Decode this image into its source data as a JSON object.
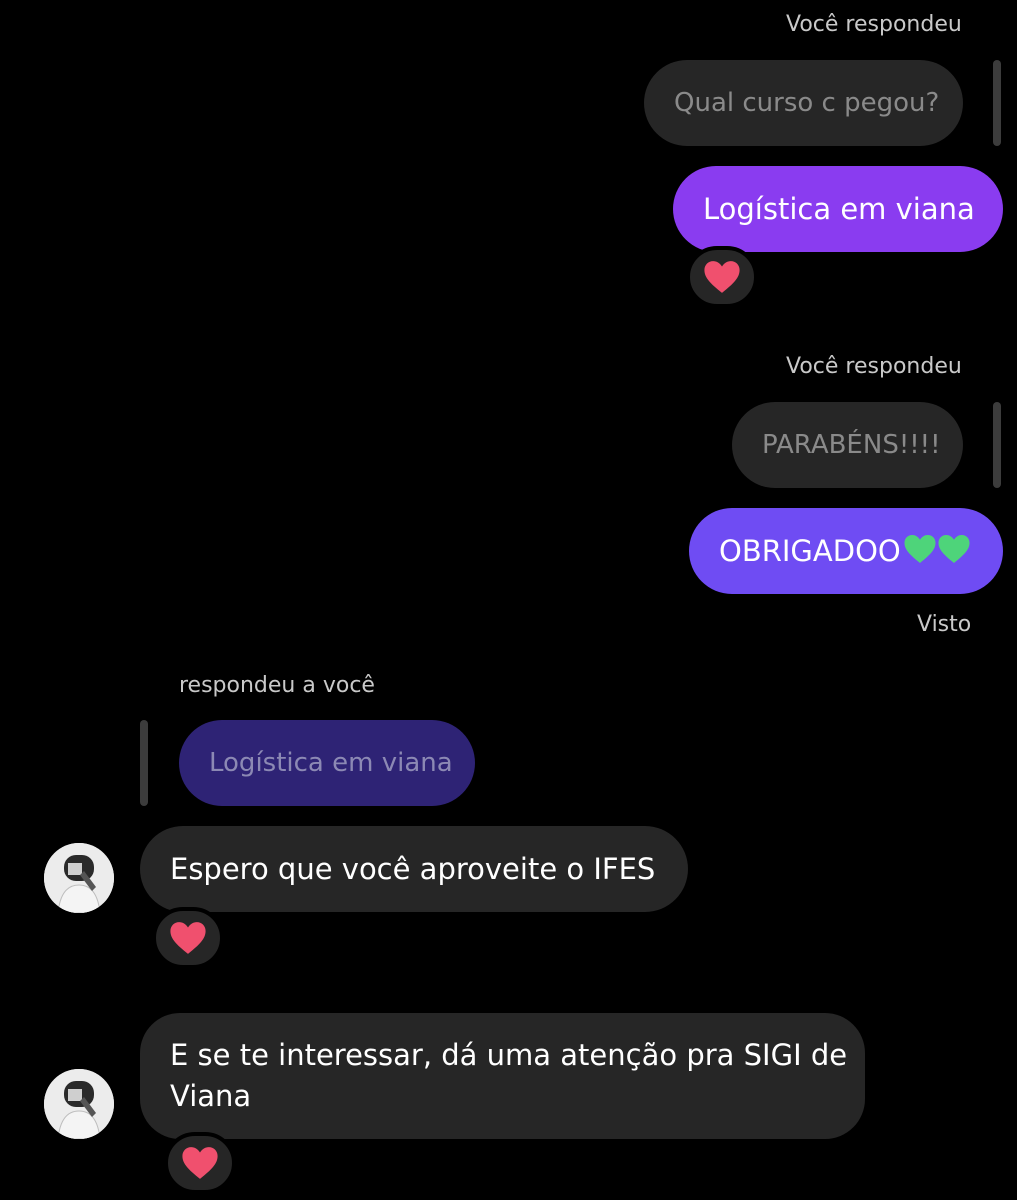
{
  "thread": {
    "reply_label_1": "Você respondeu",
    "quoted_1": "Qual curso c pegou?",
    "sent_1": "Logística em viana",
    "reply_label_2": "Você respondeu",
    "quoted_2": "PARABÉNS!!!!",
    "sent_2": "OBRIGADOO",
    "seen_label": "Visto",
    "reply_label_3": "respondeu a você",
    "quoted_3": "Logística em viana",
    "received_1": "Espero que você aproveite o IFES",
    "received_2_line1": "E se te interessar, dá uma atenção pra SIGI de",
    "received_2_line2": "Viana"
  },
  "colors": {
    "background": "#000000",
    "sent_bubble_1": "#8a3cf0",
    "sent_bubble_2": "#6f4cf3",
    "received_bubble": "#262626",
    "quoted_purple": "#2e2375",
    "heart_red": "#f0506e",
    "heart_green": "#4ed47a"
  },
  "icons": {
    "reaction": "heart-icon",
    "emoji": "green-heart-icon",
    "avatar": "avatar"
  }
}
